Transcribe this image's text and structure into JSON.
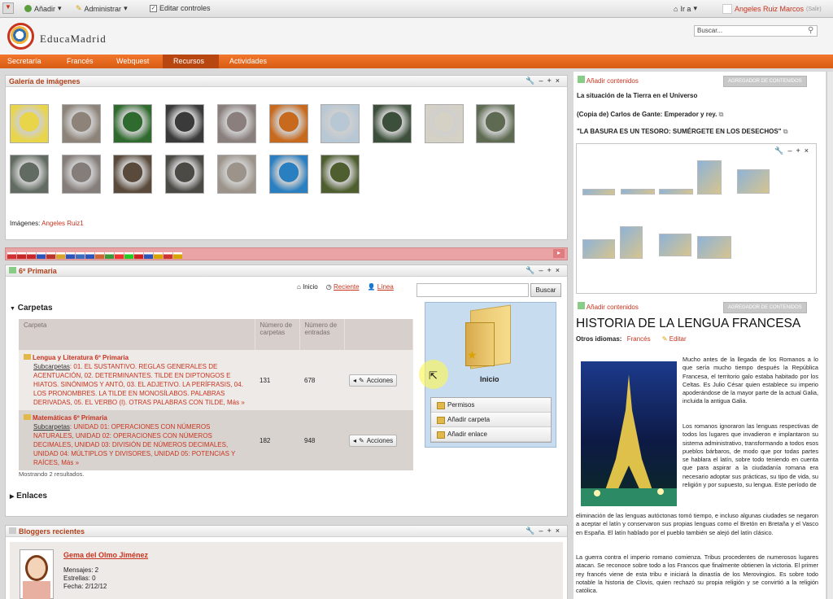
{
  "dockbar": {
    "add": "Añadir",
    "admin": "Administrar",
    "edit_controls": "Editar controles",
    "goto": "Ir a",
    "user": "Angeles Ruiz Marcos",
    "logout": "(Salir)"
  },
  "header": {
    "logo_text": "EducaMadrid",
    "search_placeholder": "Buscar..."
  },
  "nav": {
    "items": [
      "Secretaría",
      "Francés",
      "Webquest",
      "Recursos",
      "Actividades"
    ],
    "selected": "Recursos"
  },
  "gallery": {
    "title": "Galería de imágenes",
    "images_label": "Imágenes:",
    "author": "Angeles Ruiz1"
  },
  "primaria": {
    "title": "6º Primaria",
    "home": "Inicio",
    "recent": "Reciente",
    "line": "Línea",
    "search_btn": "Buscar",
    "folders_heading": "Carpetas",
    "columns": [
      "Carpeta",
      "Número de carpetas",
      "Número de entradas"
    ],
    "rows": [
      {
        "name": "Lengua y Literatura 6º Primaria",
        "sub_label": "Subcarpetas",
        "sub_text": ": 01. EL SUSTANTIVO. REGLAS GENERALES DE ACENTUACIÓN, 02. DETERMINANTES. TILDE EN DIPTONGOS E HIATOS. SINÓNIMOS Y ANTÓ, 03. EL ADJETIVO. LA PERÍFRASIS, 04. LOS PRONOMBRES. LA TILDE EN MONOSÍLABOS. PALABRAS DERIVADAS, 05. EL VERBO (I). OTRAS PALABRAS CON TILDE,",
        "more": "Más »",
        "folders": "131",
        "entries": "678",
        "actions": "Acciones"
      },
      {
        "name": "Matemáticas 6º Primaria",
        "sub_label": "Subcarpetas",
        "sub_text": ": UNIDAD 01: OPERACIONES CON NÚMEROS NATURALES, UNIDAD 02: OPERACIONES CON NÚMEROS DECIMALES, UNIDAD 03: DIVISIÓN DE NÚMEROS DECIMALES, UNIDAD 04: MÚLTIPLOS Y DIVISORES, UNIDAD 05: POTENCIAS Y RAÍCES,",
        "more": "Más »",
        "folders": "182",
        "entries": "948",
        "actions": "Acciones"
      }
    ],
    "results": "Mostrando 2 resultados.",
    "links_heading": "Enlaces",
    "home_panel": {
      "label": "Inicio",
      "menu": [
        "Permisos",
        "Añadir carpeta",
        "Añadir enlace"
      ]
    }
  },
  "bloggers": {
    "title": "Bloggers recientes",
    "name": "Gema del Olmo Jiménez",
    "messages": "Mensajes: 2",
    "stars": "Estrellas: 0",
    "date": "Fecha: 2/12/12"
  },
  "right": {
    "add_content": "Añadir contenidos",
    "aggregator": "AGREGADOR DE CONTENIDOS",
    "items": [
      "La situación de la Tierra en el Universo",
      "(Copia de) Carlos de Gante: Emperador y rey.",
      "\"LA BASURA ES UN TESORO: SUMÉRGETE EN LOS DESECHOS\""
    ],
    "article_title": "HISTORIA DE LA LENGUA FRANCESA",
    "other_langs": "Otros idiomas:",
    "lang": "Francés",
    "edit": "Editar",
    "para1": "Mucho antes de la llegada de los Romanos a lo que sería mucho tiempo después la República Francesa, el territorio galo estaba habitado por los Celtas. Es Julio César quien establece su imperio apoderándose de la mayor parte de la actual Galia, incluida la antigua Galia.",
    "para2a": "Los romanos ignoraron las lenguas respectivas de todos los lugares que invadieron e implantaron su sistema administrativo, transformando a todos esos pueblos bárbaros, de modo que por todas partes se hablara el latín, sobre todo teniendo en cuenta que para aspirar a la ciudadanía romana era necesario adoptar sus prácticas, su tipo de vida, su religión y por supuesto, su lengua. Este período de",
    "para2b": "eliminación de las lenguas autóctonas tomó tiempo, e incluso algunas ciudades se negaron a aceptar el latín y conservaron sus propias lenguas como el Bretón en Bretaña y el Vasco en España. El latín hablado por el pueblo también se alejó del latín clásico.",
    "para3": "La guerra contra el imperio romano comienza. Tribus procedentes de numerosos lugares atacan. Se reconoce sobre todo a los Francos que finalmente obtienen la victoria. El primer rey francés viene de esta tribu e iniciará la dinastía de los Merovingios. Es sobre todo notable la historia de Clovis, quien rechazó su propia religión y se convirtió a la religión católica."
  },
  "colors": {
    "accent": "#e46b1f",
    "link": "#c8331e",
    "title": "#b0401a"
  }
}
